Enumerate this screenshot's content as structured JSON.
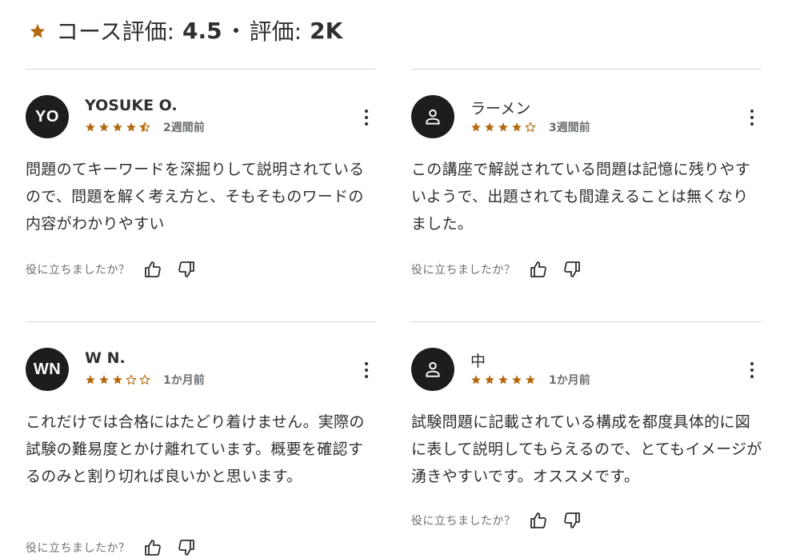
{
  "header": {
    "rating_label": "コース評価:",
    "rating_value": "4.5",
    "count_label": "評価:",
    "count_value": "2K",
    "star_color": "#b4690e"
  },
  "helpful_label": "役に立ちましたか？",
  "reviews": [
    {
      "avatar_text": "YO",
      "avatar_icon": "",
      "name": "YOSUKE O.",
      "rating": 4.5,
      "time": "2週間前",
      "text": "問題のてキーワードを深掘りして説明されているので、問題を解く考え方と、そもそものワードの内容がわかりやすい"
    },
    {
      "avatar_text": "",
      "avatar_icon": "user-icon",
      "name": "ラーメン",
      "rating": 4,
      "time": "3週間前",
      "text": "この講座で解説されている問題は記憶に残りやすいようで、出題されても間違えることは無くなりました。"
    },
    {
      "avatar_text": "WN",
      "avatar_icon": "",
      "name": "W N.",
      "rating": 3,
      "time": "1か月前",
      "text": "これだけでは合格にはたどり着けません。実際の試験の難易度とかけ離れています。概要を確認するのみと割り切れば良いかと思います。"
    },
    {
      "avatar_text": "",
      "avatar_icon": "user-icon",
      "name": "中",
      "rating": 5,
      "time": "1か月前",
      "text": "試験問題に記載されている構成を都度具体的に図に表して説明してもらえるので、とてもイメージが湧きやすいです。オススメです。"
    }
  ]
}
